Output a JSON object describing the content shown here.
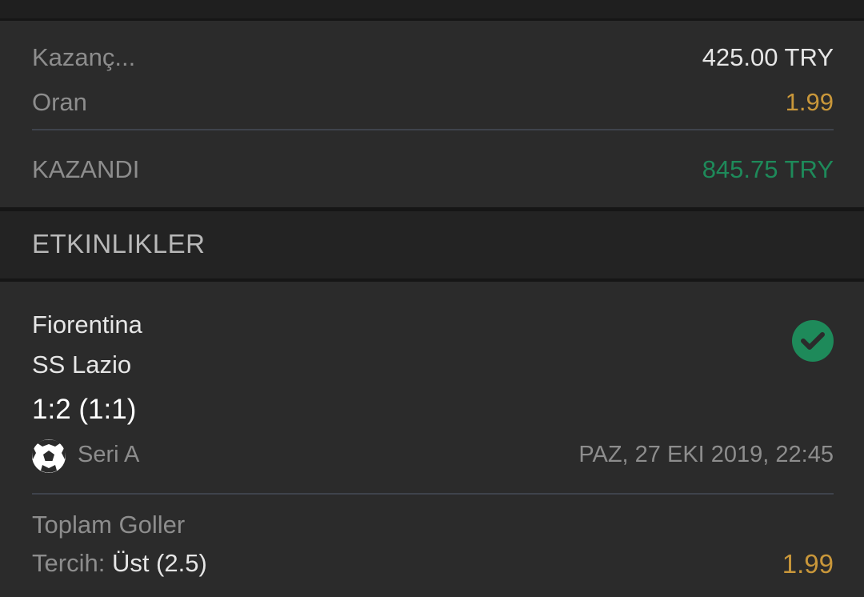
{
  "summary": {
    "stake_label": "Kazanç...",
    "stake_value": "425.00 TRY",
    "odds_label": "Oran",
    "odds_value": "1.99",
    "result_label": "KAZANDI",
    "result_value": "845.75 TRY"
  },
  "section": {
    "title": "ETKINLIKLER"
  },
  "event": {
    "home_team": "Fiorentina",
    "away_team": "SS Lazio",
    "score": "1:2 (1:1)",
    "status_icon": "check-circle-icon",
    "sport_icon": "soccer-ball-icon",
    "league": "Seri A",
    "datetime": "PAZ, 27 EKI 2019, 22:45",
    "market": "Toplam Goller",
    "choice_label": "Tercih:",
    "choice_value": "Üst (2.5)",
    "odds": "1.99"
  },
  "colors": {
    "background": "#2b2b2b",
    "header_background": "#232323",
    "accent_gold": "#c9973a",
    "win_green": "#1e8a5a"
  }
}
